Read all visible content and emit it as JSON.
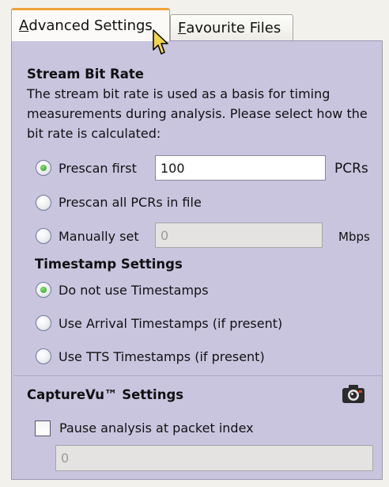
{
  "tabs": [
    {
      "label_u": "A",
      "label_rest": "dvanced Settings"
    },
    {
      "label_u": "F",
      "label_rest": "avourite Files"
    }
  ],
  "stream": {
    "title": "Stream Bit Rate",
    "description": "The stream bit rate is used as a basis for timing measurements during analysis. Please select how the bit rate is calculated:",
    "prescan_first_label": "Prescan first",
    "prescan_first_value": "100",
    "pcrs_unit": "PCRs",
    "prescan_all_label": "Prescan all PCRs in file",
    "manual_label": "Manually set",
    "manual_value": "0",
    "mbps_unit": "Mbps"
  },
  "timestamp": {
    "title": "Timestamp Settings",
    "options": [
      {
        "label": "Do not use Timestamps",
        "selected": true
      },
      {
        "label": "Use Arrival Timestamps (if present)",
        "selected": false
      },
      {
        "label": "Use TTS Timestamps (if present)",
        "selected": false
      }
    ]
  },
  "capture": {
    "title": "CaptureVu™ Settings",
    "pause_label": "Pause analysis at packet index",
    "pause_checked": false,
    "packet_index_value": "0"
  },
  "colors": {
    "panel_bg": "#c9c5df",
    "tab_accent": "#f1a23a",
    "radio_selected": "#239a1c"
  },
  "icons": {
    "cursor": "arrow-cursor-icon",
    "camera": "camera-icon"
  }
}
